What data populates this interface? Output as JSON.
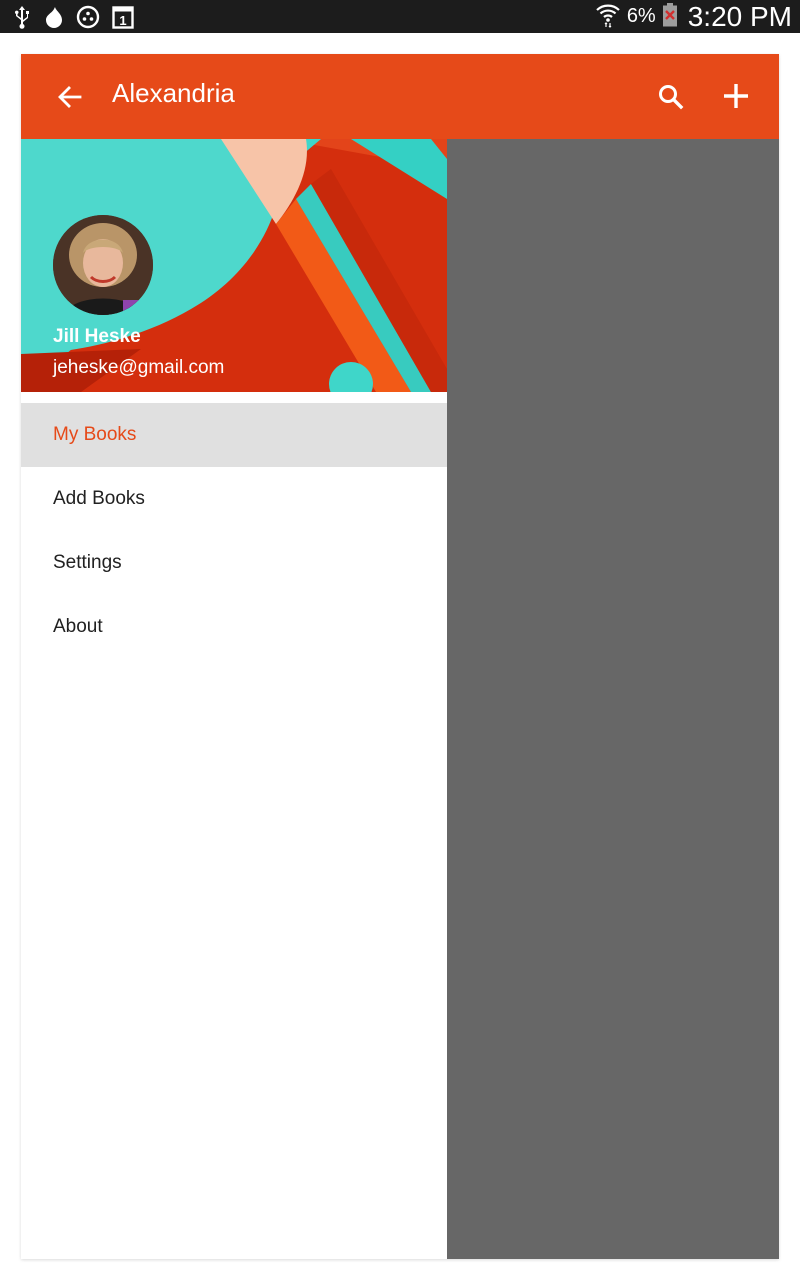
{
  "status_bar": {
    "icons_left": [
      "usb-icon",
      "drop-icon",
      "circle-dots-icon",
      "calendar-icon"
    ],
    "calendar_day": "1",
    "battery_percent": "6%",
    "time": "3:20 PM"
  },
  "toolbar": {
    "title": "Alexandria",
    "back_icon": "arrow-left-icon",
    "search_icon": "search-icon",
    "add_icon": "plus-icon",
    "color": "#e64a19"
  },
  "drawer": {
    "user": {
      "name": "Jill Heske",
      "email": "jeheske@gmail.com"
    },
    "menu": [
      {
        "label": "My Books",
        "active": true
      },
      {
        "label": "Add Books",
        "active": false
      },
      {
        "label": "Settings",
        "active": false
      },
      {
        "label": "About",
        "active": false
      }
    ],
    "active_color": "#e64a19"
  }
}
